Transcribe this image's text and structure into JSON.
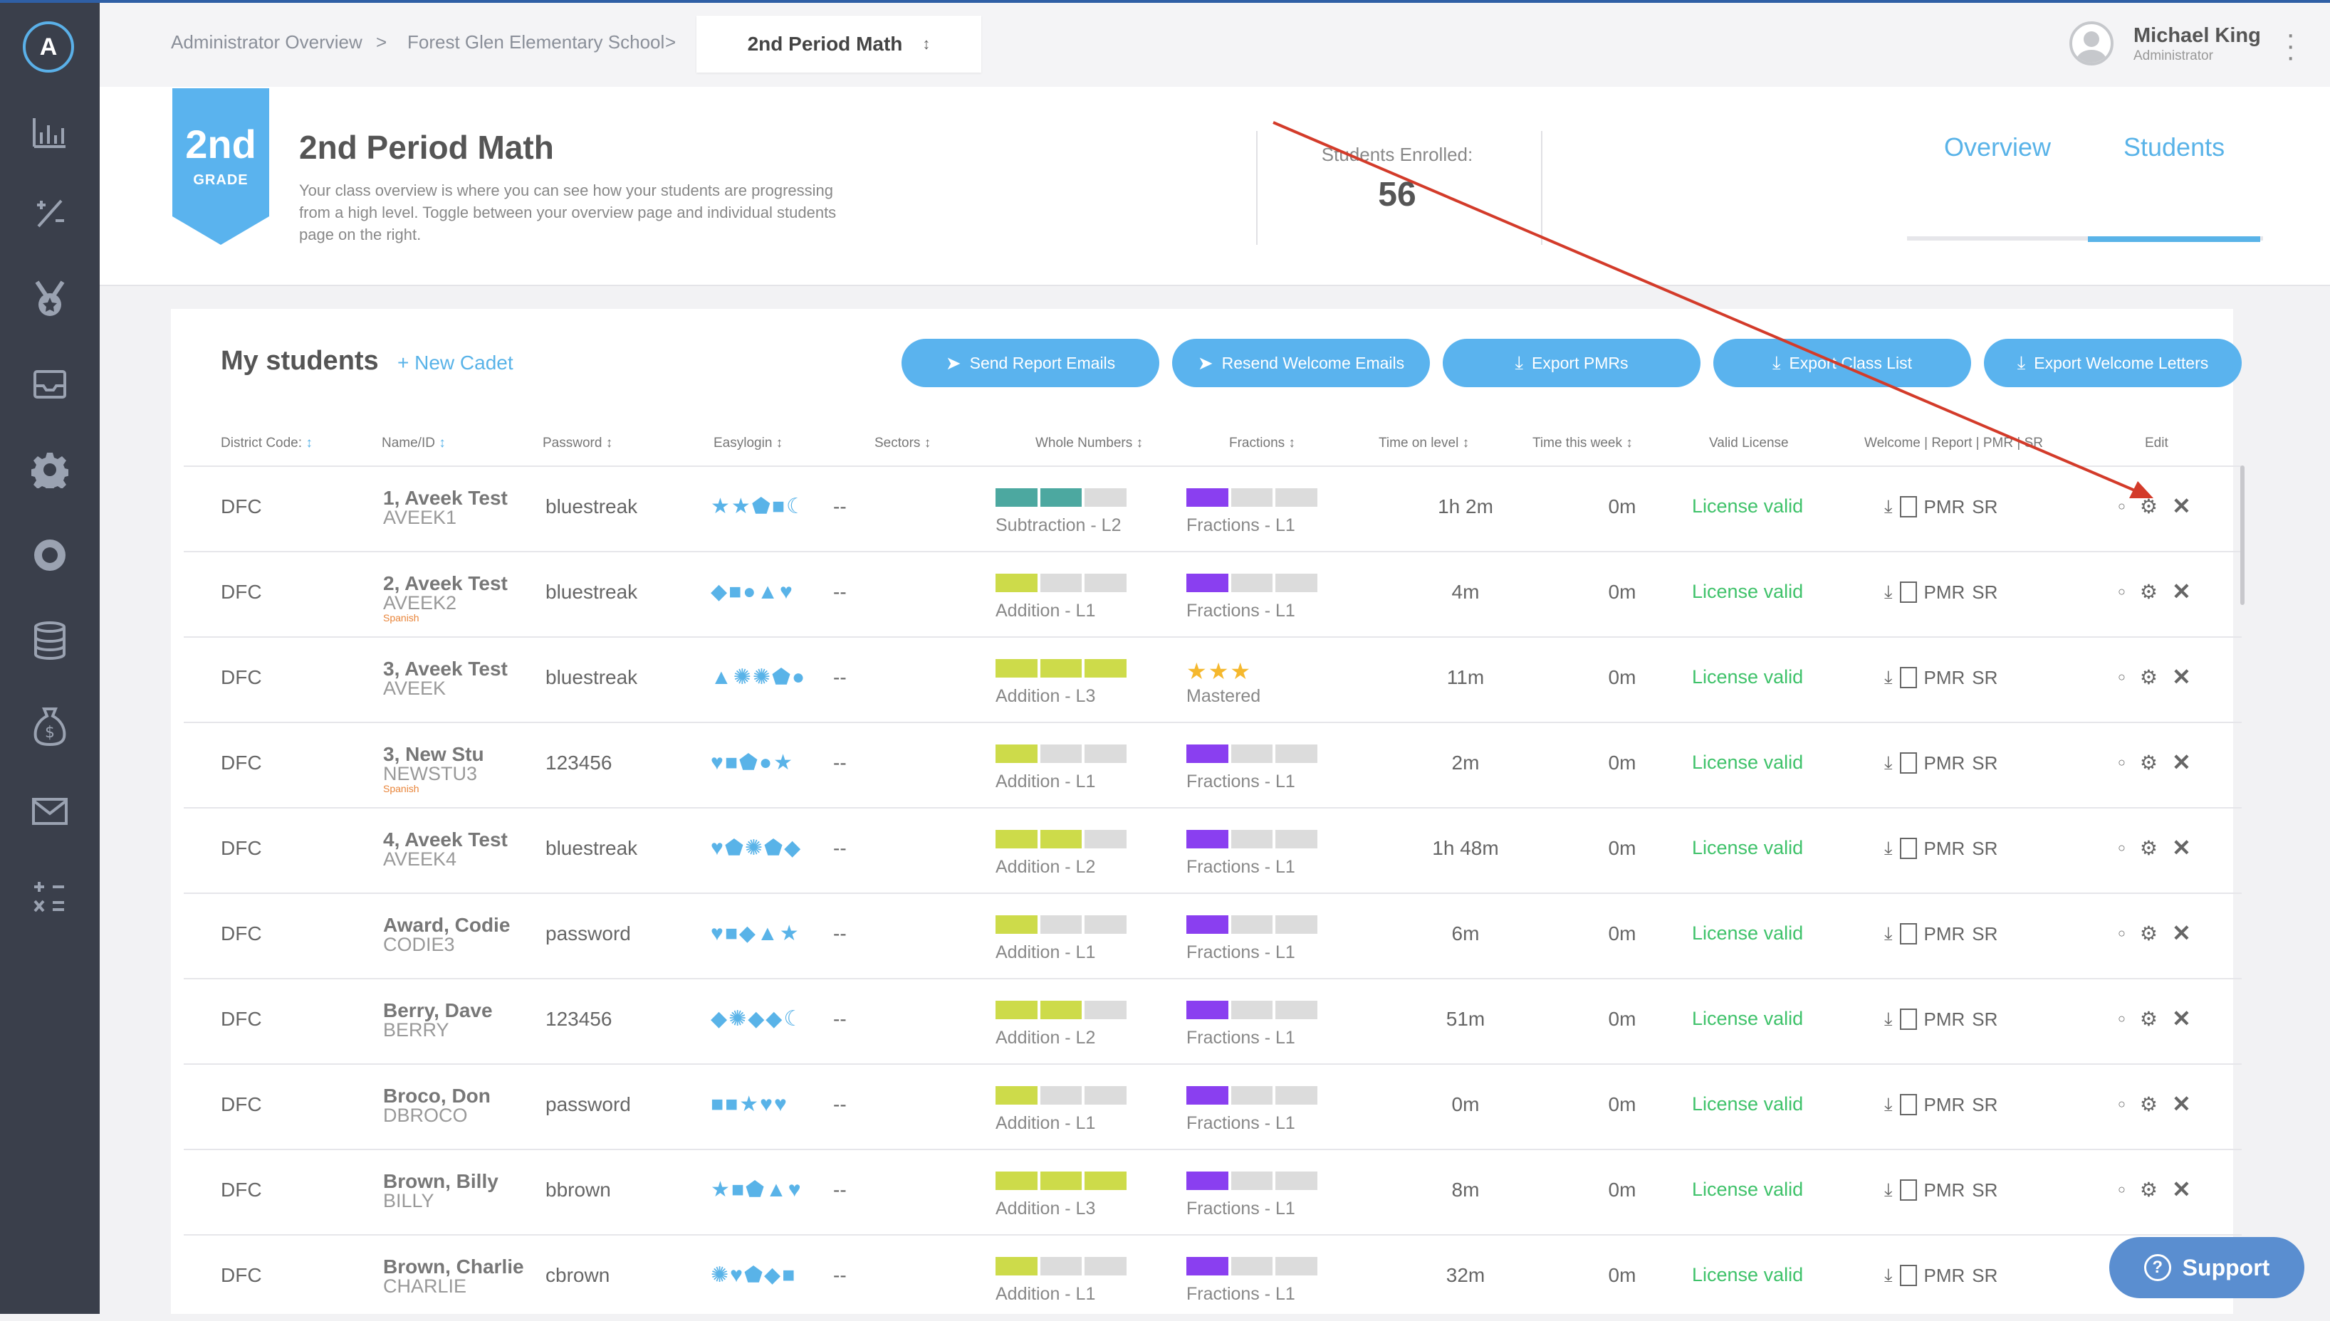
{
  "breadcrumb": {
    "items": [
      "Administrator Overview",
      "Forest Glen Elementary School"
    ],
    "separator": ">",
    "active": "2nd Period Math",
    "active_icon": "sort-arrows-icon"
  },
  "user": {
    "name": "Michael King",
    "role": "Administrator"
  },
  "sidebar": {
    "logo": "A",
    "icons": [
      "chart-icon",
      "operations-icon",
      "medal-icon",
      "inbox-icon",
      "gear-icon",
      "lifebuoy-icon",
      "database-icon",
      "money-bag-icon",
      "mail-icon",
      "calculator-icon"
    ]
  },
  "class": {
    "badge_num": "2nd",
    "badge_label": "GRADE",
    "title": "2nd Period Math",
    "description": "Your class overview is where you can see how your students are progressing from a high level. Toggle between your overview page and individual students page on the right.",
    "enrolled_label": "Students Enrolled:",
    "enrolled_count": "56",
    "tabs": [
      "Overview",
      "Students"
    ],
    "active_tab": "Students"
  },
  "students": {
    "title": "My students",
    "new_cadet": "+ New Cadet",
    "buttons": [
      "Send Report Emails",
      "Resend Welcome Emails",
      "Export PMRs",
      "Export Class List",
      "Export Welcome Letters"
    ],
    "headers": {
      "district": "District Code:",
      "name": "Name/ID",
      "password": "Password",
      "easylogin": "Easylogin",
      "sectors": "Sectors",
      "whole": "Whole Numbers",
      "fractions": "Fractions",
      "time_level": "Time on level",
      "time_week": "Time this week",
      "license": "Valid License",
      "welcome": "Welcome | Report | PMR | SR",
      "edit": "Edit"
    },
    "rows": [
      {
        "district": "DFC",
        "name": "1, Aveek Test",
        "id": "AVEEK1",
        "lang": "",
        "password": "bluestreak",
        "easylogin": "★★⬟■☾",
        "sectors": "--",
        "whole_fill": 2,
        "whole_color": "#4ca8a0",
        "whole_label": "Subtraction - L2",
        "frac_fill": 1,
        "frac_label": "Fractions - L1",
        "mastered": false,
        "time_level": "1h 2m",
        "time_week": "0m",
        "license": "License valid",
        "pmr": "PMR",
        "sr": "SR"
      },
      {
        "district": "DFC",
        "name": "2, Aveek Test",
        "id": "AVEEK2",
        "lang": "Spanish",
        "password": "bluestreak",
        "easylogin": "◆■●▲♥",
        "sectors": "--",
        "whole_fill": 1,
        "whole_color": "#cddb4a",
        "whole_label": "Addition - L1",
        "frac_fill": 1,
        "frac_label": "Fractions - L1",
        "mastered": false,
        "time_level": "4m",
        "time_week": "0m",
        "license": "License valid",
        "pmr": "PMR",
        "sr": "SR"
      },
      {
        "district": "DFC",
        "name": "3, Aveek Test",
        "id": "AVEEK",
        "lang": "",
        "password": "bluestreak",
        "easylogin": "▲✺✺⬟●",
        "sectors": "--",
        "whole_fill": 3,
        "whole_color": "#cddb4a",
        "whole_label": "Addition - L3",
        "frac_fill": 0,
        "frac_label": "Mastered",
        "mastered": true,
        "stars": "★★★",
        "time_level": "11m",
        "time_week": "0m",
        "license": "License valid",
        "pmr": "PMR",
        "sr": "SR"
      },
      {
        "district": "DFC",
        "name": "3, New Stu",
        "id": "NEWSTU3",
        "lang": "Spanish",
        "password": "123456",
        "easylogin": "♥■⬟●★",
        "sectors": "--",
        "whole_fill": 1,
        "whole_color": "#cddb4a",
        "whole_label": "Addition - L1",
        "frac_fill": 1,
        "frac_label": "Fractions - L1",
        "mastered": false,
        "time_level": "2m",
        "time_week": "0m",
        "license": "License valid",
        "pmr": "PMR",
        "sr": "SR"
      },
      {
        "district": "DFC",
        "name": "4, Aveek Test",
        "id": "AVEEK4",
        "lang": "",
        "password": "bluestreak",
        "easylogin": "♥⬟✺⬟◆",
        "sectors": "--",
        "whole_fill": 2,
        "whole_color": "#cddb4a",
        "whole_label": "Addition - L2",
        "frac_fill": 1,
        "frac_label": "Fractions - L1",
        "mastered": false,
        "time_level": "1h 48m",
        "time_week": "0m",
        "license": "License valid",
        "pmr": "PMR",
        "sr": "SR"
      },
      {
        "district": "DFC",
        "name": "Award, Codie",
        "id": "CODIE3",
        "lang": "",
        "password": "password",
        "easylogin": "♥■◆▲★",
        "sectors": "--",
        "whole_fill": 1,
        "whole_color": "#cddb4a",
        "whole_label": "Addition - L1",
        "frac_fill": 1,
        "frac_label": "Fractions - L1",
        "mastered": false,
        "time_level": "6m",
        "time_week": "0m",
        "license": "License valid",
        "pmr": "PMR",
        "sr": "SR"
      },
      {
        "district": "DFC",
        "name": "Berry, Dave",
        "id": "BERRY",
        "lang": "",
        "password": "123456",
        "easylogin": "◆✺◆◆☾",
        "sectors": "--",
        "whole_fill": 2,
        "whole_color": "#cddb4a",
        "whole_label": "Addition - L2",
        "frac_fill": 1,
        "frac_label": "Fractions - L1",
        "mastered": false,
        "time_level": "51m",
        "time_week": "0m",
        "license": "License valid",
        "pmr": "PMR",
        "sr": "SR"
      },
      {
        "district": "DFC",
        "name": "Broco, Don",
        "id": "DBROCO",
        "lang": "",
        "password": "password",
        "easylogin": "■■★♥♥",
        "sectors": "--",
        "whole_fill": 1,
        "whole_color": "#cddb4a",
        "whole_label": "Addition - L1",
        "frac_fill": 1,
        "frac_label": "Fractions - L1",
        "mastered": false,
        "time_level": "0m",
        "time_week": "0m",
        "license": "License valid",
        "pmr": "PMR",
        "sr": "SR"
      },
      {
        "district": "DFC",
        "name": "Brown, Billy",
        "id": "BILLY",
        "lang": "",
        "password": "bbrown",
        "easylogin": "★■⬟▲♥",
        "sectors": "--",
        "whole_fill": 3,
        "whole_color": "#cddb4a",
        "whole_label": "Addition - L3",
        "frac_fill": 1,
        "frac_label": "Fractions - L1",
        "mastered": false,
        "time_level": "8m",
        "time_week": "0m",
        "license": "License valid",
        "pmr": "PMR",
        "sr": "SR"
      },
      {
        "district": "DFC",
        "name": "Brown, Charlie",
        "id": "CHARLIE",
        "lang": "",
        "password": "cbrown",
        "easylogin": "✺♥⬟◆■",
        "sectors": "--",
        "whole_fill": 1,
        "whole_color": "#cddb4a",
        "whole_label": "Addition - L1",
        "frac_fill": 1,
        "frac_label": "Fractions - L1",
        "mastered": false,
        "time_level": "32m",
        "time_week": "0m",
        "license": "License valid",
        "pmr": "PMR",
        "sr": "SR"
      }
    ]
  },
  "support": {
    "label": "Support"
  },
  "colors": {
    "accent": "#59b3e8",
    "fraction": "#8a3ff0",
    "license": "#3fc26a",
    "annotation": "#d33b2a"
  }
}
